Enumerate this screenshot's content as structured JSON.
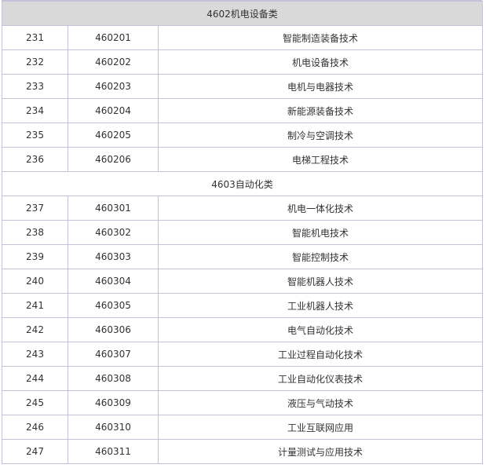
{
  "sections": [
    {
      "title": "4602机电设备类",
      "style": "shaded",
      "rows": [
        {
          "no": "231",
          "code": "460201",
          "name": "智能制造装备技术"
        },
        {
          "no": "232",
          "code": "460202",
          "name": "机电设备技术"
        },
        {
          "no": "233",
          "code": "460203",
          "name": "电机与电器技术"
        },
        {
          "no": "234",
          "code": "460204",
          "name": "新能源装备技术"
        },
        {
          "no": "235",
          "code": "460205",
          "name": "制冷与空调技术"
        },
        {
          "no": "236",
          "code": "460206",
          "name": "电梯工程技术"
        }
      ]
    },
    {
      "title": "4603自动化类",
      "style": "plain",
      "rows": [
        {
          "no": "237",
          "code": "460301",
          "name": "机电一体化技术"
        },
        {
          "no": "238",
          "code": "460302",
          "name": "智能机电技术"
        },
        {
          "no": "239",
          "code": "460303",
          "name": "智能控制技术"
        },
        {
          "no": "240",
          "code": "460304",
          "name": "智能机器人技术"
        },
        {
          "no": "241",
          "code": "460305",
          "name": "工业机器人技术"
        },
        {
          "no": "242",
          "code": "460306",
          "name": "电气自动化技术"
        },
        {
          "no": "243",
          "code": "460307",
          "name": "工业过程自动化技术"
        },
        {
          "no": "244",
          "code": "460308",
          "name": "工业自动化仪表技术"
        },
        {
          "no": "245",
          "code": "460309",
          "name": "液压与气动技术"
        },
        {
          "no": "246",
          "code": "460310",
          "name": "工业互联网应用"
        },
        {
          "no": "247",
          "code": "460311",
          "name": "计量测试与应用技术"
        }
      ]
    }
  ]
}
